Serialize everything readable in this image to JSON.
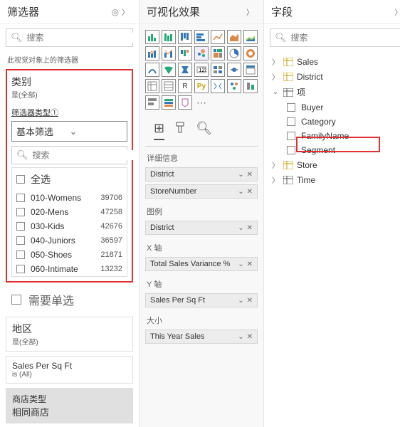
{
  "filters": {
    "title": "筛选器",
    "search_placeholder": "搜索",
    "scope": "此视觉对象上的筛选器",
    "category": {
      "title": "类别",
      "sub": "是(全部)",
      "filterTypeLabel": "筛选器类型①",
      "filterType": "基本筛选",
      "searchPlaceholder": "搜索",
      "selectAll": "全选",
      "values": [
        {
          "label": "010-Womens",
          "count": "39706"
        },
        {
          "label": "020-Mens",
          "count": "47258"
        },
        {
          "label": "030-Kids",
          "count": "42676"
        },
        {
          "label": "040-Juniors",
          "count": "36597"
        },
        {
          "label": "050-Shoes",
          "count": "21871"
        },
        {
          "label": "060-Intimate",
          "count": "13232"
        }
      ]
    },
    "requireSingle": "需要单选",
    "districtCard": {
      "title": "地区",
      "sub": "是(全部)"
    },
    "salesCard": {
      "title": "Sales Per Sq Ft",
      "sub": "is (All)"
    },
    "storeTypeCard": {
      "title": "商店类型",
      "sub": "相同商店"
    }
  },
  "viz": {
    "title": "可视化效果",
    "sections": {
      "detail": "详细信息",
      "legend": "图例",
      "x": "X 轴",
      "y": "Y 轴",
      "size": "大小"
    },
    "fields": {
      "detail": [
        "District",
        "StoreNumber"
      ],
      "legend": [
        "District"
      ],
      "x": [
        "Total Sales Variance %"
      ],
      "y": [
        "Sales Per Sq Ft"
      ],
      "size": [
        "This Year Sales"
      ]
    }
  },
  "fields": {
    "title": "字段",
    "search_placeholder": "搜索",
    "tables": {
      "sales": "Sales",
      "district": "District",
      "item": "项",
      "store": "Store",
      "time": "Time"
    },
    "itemChildren": [
      "Buyer",
      "Category",
      "FamilyName",
      "Segment"
    ]
  }
}
